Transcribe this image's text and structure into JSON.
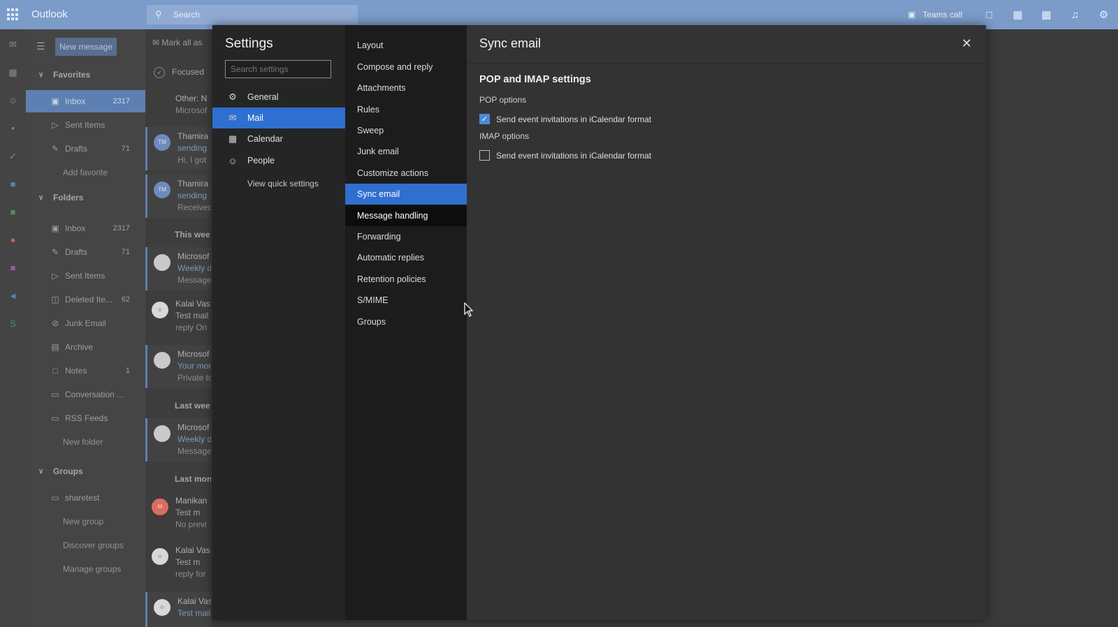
{
  "app": {
    "title": "Outlook"
  },
  "search": {
    "placeholder": "Search"
  },
  "header": {
    "teams_call": "Teams call"
  },
  "compose": {
    "new_message": "New message",
    "mark_all_read": "Mark all as"
  },
  "nav": {
    "favorites": {
      "label": "Favorites",
      "items": [
        {
          "label": "Inbox",
          "count": "2317",
          "icon": "inbox-icon"
        },
        {
          "label": "Sent Items",
          "count": "",
          "icon": "send-icon"
        },
        {
          "label": "Drafts",
          "count": "71",
          "icon": "pencil-icon"
        }
      ],
      "add": "Add favorite"
    },
    "folders": {
      "label": "Folders",
      "items": [
        {
          "label": "Inbox",
          "count": "2317",
          "icon": "inbox-icon"
        },
        {
          "label": "Drafts",
          "count": "71",
          "icon": "pencil-icon"
        },
        {
          "label": "Sent Items",
          "count": "",
          "icon": "send-icon"
        },
        {
          "label": "Deleted Ite...",
          "count": "62",
          "icon": "trash-icon"
        },
        {
          "label": "Junk Email",
          "count": "",
          "icon": "block-icon"
        },
        {
          "label": "Archive",
          "count": "",
          "icon": "archive-icon"
        },
        {
          "label": "Notes",
          "count": "1",
          "icon": "note-icon"
        },
        {
          "label": "Conversation ...",
          "count": "",
          "icon": "folder-icon"
        },
        {
          "label": "RSS Feeds",
          "count": "",
          "icon": "folder-icon"
        }
      ],
      "new": "New folder"
    },
    "groups": {
      "label": "Groups",
      "items": [
        {
          "label": "sharetest",
          "icon": "folder-icon"
        }
      ],
      "new": "New group",
      "discover": "Discover groups",
      "manage": "Manage groups"
    }
  },
  "message_list": {
    "focused": "Focused",
    "other": "Other: N",
    "other_sub": "Microsof",
    "sections": {
      "this_week": "This wee",
      "last_week": "Last wee",
      "last_month": "Last mon"
    },
    "messages": [
      {
        "initials": "TM",
        "from": "Thamira",
        "line2": "sending",
        "line3": "Hi, I got"
      },
      {
        "initials": "TM",
        "from": "Thamira",
        "line2": "sending",
        "line3": "Received"
      },
      {
        "initials": "",
        "from": "Microsof",
        "line2": "Weekly d",
        "line3": "Message"
      },
      {
        "initials": "",
        "from": "Kalai Vas",
        "line2": "Test mail",
        "line3": "reply On"
      },
      {
        "initials": "",
        "from": "Microsof",
        "line2": "Your mor",
        "line3": "Private to"
      },
      {
        "initials": "",
        "from": "Microsof",
        "line2": "Weekly d",
        "line3": "Message"
      },
      {
        "initials": "M",
        "from": "Manikan",
        "line2": "Test m",
        "line3": "No previ"
      },
      {
        "initials": "",
        "from": "Kalai Vas",
        "line2": "Test m",
        "line3": "reply for"
      },
      {
        "initials": "",
        "from": "Kalai Vas",
        "line2": "Test mail EWS with att",
        "line3": ""
      }
    ]
  },
  "settings": {
    "title": "Settings",
    "search_placeholder": "Search settings",
    "categories": [
      {
        "label": "General",
        "icon": "gear-icon"
      },
      {
        "label": "Mail",
        "icon": "mail-icon"
      },
      {
        "label": "Calendar",
        "icon": "calendar-icon"
      },
      {
        "label": "People",
        "icon": "people-icon"
      }
    ],
    "quick_settings": "View quick settings",
    "mail_sections": [
      "Layout",
      "Compose and reply",
      "Attachments",
      "Rules",
      "Sweep",
      "Junk email",
      "Customize actions",
      "Sync email",
      "Message handling",
      "Forwarding",
      "Automatic replies",
      "Retention policies",
      "S/MIME",
      "Groups"
    ],
    "pane": {
      "title": "Sync email",
      "heading": "POP and IMAP settings",
      "pop_label": "POP options",
      "pop_checkbox": {
        "label": "Send event invitations in iCalendar format",
        "checked": true
      },
      "imap_label": "IMAP options",
      "imap_checkbox": {
        "label": "Send event invitations in iCalendar format",
        "checked": false
      }
    }
  },
  "colors": {
    "accent": "#2f6fd0",
    "topbar": "#7b9bc9",
    "checkbox_on": "#4a8ad6"
  }
}
